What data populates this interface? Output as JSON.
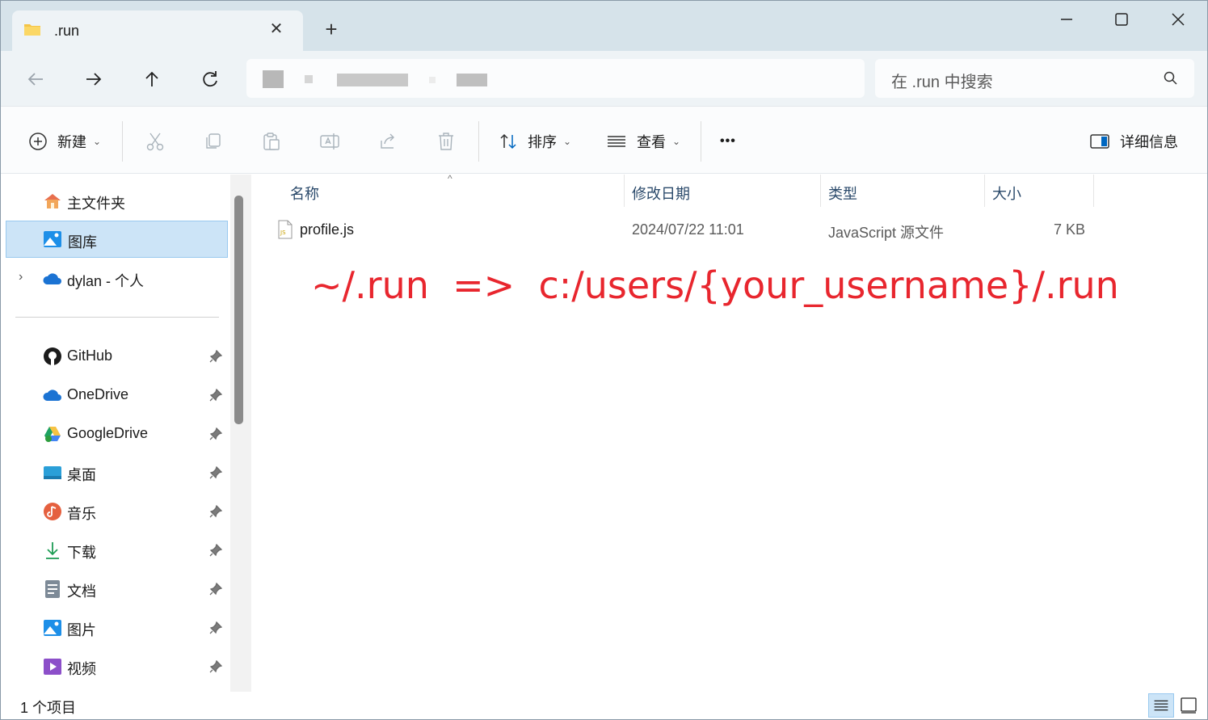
{
  "tab": {
    "title": ".run",
    "close_glyph": "✕",
    "add_glyph": "+"
  },
  "window_controls": [
    "minimize-icon",
    "maximize-icon",
    "close-icon"
  ],
  "navigation": [
    "back-arrow-icon",
    "forward-arrow-icon",
    "up-arrow-icon",
    "refresh-icon"
  ],
  "search": {
    "placeholder": "在 .run 中搜索"
  },
  "toolbar": {
    "new_label": "新建",
    "sort_label": "排序",
    "view_label": "查看",
    "more_label": "•••",
    "details_label": "详细信息",
    "chevron": "⌄"
  },
  "sidebar": {
    "home": "主文件夹",
    "gallery": "图库",
    "onedrive_personal": "dylan - 个人",
    "expander": "›",
    "pinned": [
      {
        "label": "GitHub",
        "icon": "github-icon"
      },
      {
        "label": "OneDrive",
        "icon": "onedrive-icon"
      },
      {
        "label": "GoogleDrive",
        "icon": "googledrive-icon"
      },
      {
        "label": "桌面",
        "icon": "desktop-icon"
      },
      {
        "label": "音乐",
        "icon": "music-icon"
      },
      {
        "label": "下载",
        "icon": "download-icon"
      },
      {
        "label": "文档",
        "icon": "documents-icon"
      },
      {
        "label": "图片",
        "icon": "pictures-icon"
      },
      {
        "label": "视频",
        "icon": "videos-icon"
      }
    ]
  },
  "columns": {
    "name": "名称",
    "modified": "修改日期",
    "type": "类型",
    "size": "大小",
    "sort_caret": "^"
  },
  "files": [
    {
      "name": "profile.js",
      "modified": "2024/07/22 11:01",
      "type": "JavaScript 源文件",
      "size": "7 KB"
    }
  ],
  "annotation": "~/.run  =>  c:/users/{your_username}/.run",
  "status": {
    "item_count": "1 个项目"
  },
  "colors": {
    "accent": "#0067c0",
    "selection": "#cce4f7",
    "annotation": "#e8262e",
    "titlebar": "#d6e3ea"
  }
}
